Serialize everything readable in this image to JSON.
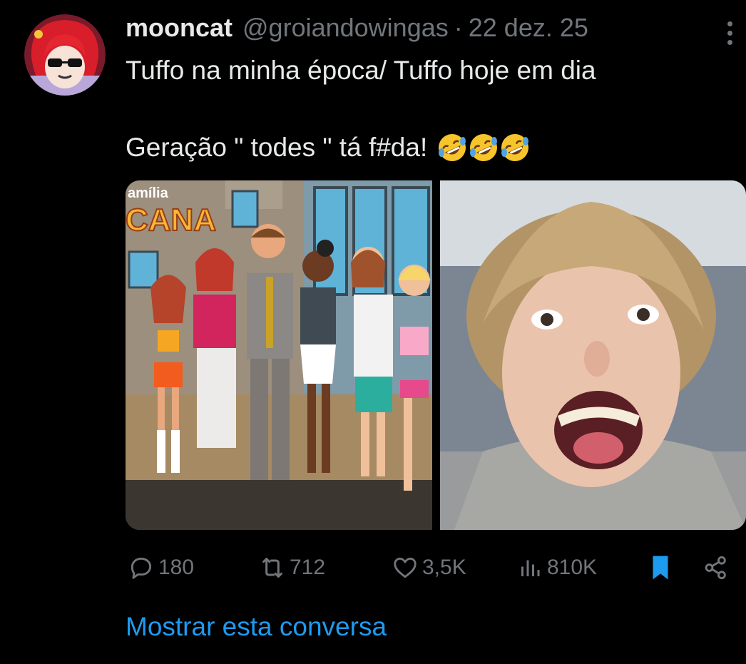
{
  "tweet": {
    "author_name": "mooncat",
    "author_handle": "@groiandowingas",
    "separator": "·",
    "date": "22 dez. 25",
    "text_line1": "Tuffo na minha época/ Tuffo hoje em dia",
    "text_line2": "Geração \" todes \" tá f#da!",
    "emoji_icon": "rolling-on-floor-laughing-emoji",
    "emoji_count": 3
  },
  "media": {
    "left_image": {
      "caption_line1": "amília",
      "caption_line2": "CANA"
    },
    "right_image": {}
  },
  "actions": {
    "replies": "180",
    "reposts": "712",
    "likes": "3,5K",
    "views": "810K"
  },
  "show_conversation": "Mostrar esta conversa",
  "colors": {
    "background": "#000000",
    "text_primary": "#e7e9ea",
    "text_secondary": "#71767b",
    "accent_blue": "#1d9bf0"
  }
}
